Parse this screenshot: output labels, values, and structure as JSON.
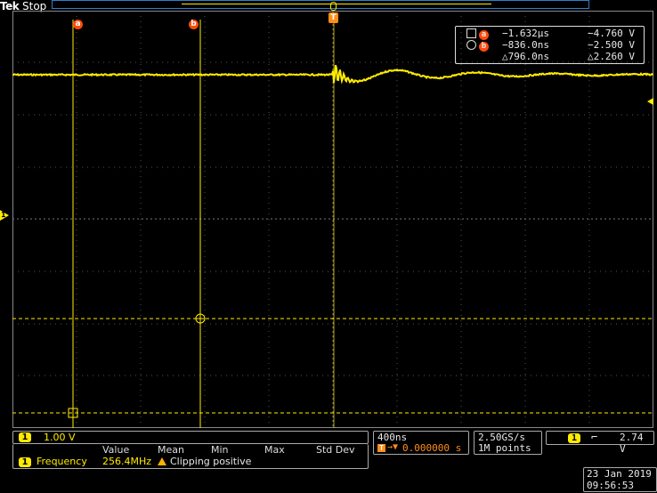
{
  "header": {
    "brand": "Tek",
    "acq_state": "Stop"
  },
  "markers": {
    "cursor_a": "a",
    "cursor_b": "b",
    "trigger": "T",
    "channel": "1"
  },
  "cursor_readout": {
    "a_time": "−1.632µs",
    "a_volt": "−4.760 V",
    "b_time": "−836.0ns",
    "b_volt": "−2.500 V",
    "delta_time": "△796.0ns",
    "delta_volt": "△2.260 V"
  },
  "channel_panel": {
    "channel": "1",
    "scale": "1.00 V"
  },
  "measurement": {
    "headers": [
      "Value",
      "Mean",
      "Min",
      "Max",
      "Std Dev"
    ],
    "channel": "1",
    "name": "Frequency",
    "value": "256.4MHz",
    "warning": "Clipping positive"
  },
  "timebase": {
    "scale": "400ns",
    "position": "0.000000 s"
  },
  "acquisition": {
    "rate": "2.50GS/s",
    "record": "1M points"
  },
  "trigger": {
    "channel": "1",
    "slope_symbol": "⌥",
    "level": "2.74 V"
  },
  "datetime": {
    "date": "23 Jan  2019",
    "time": "09:56:53"
  },
  "colors": {
    "trace": "#ffeb00",
    "cursor_badge": "#ff4a0a",
    "timebase_accent": "#ff8c1a",
    "record_bar": "#2f7fd0"
  }
}
